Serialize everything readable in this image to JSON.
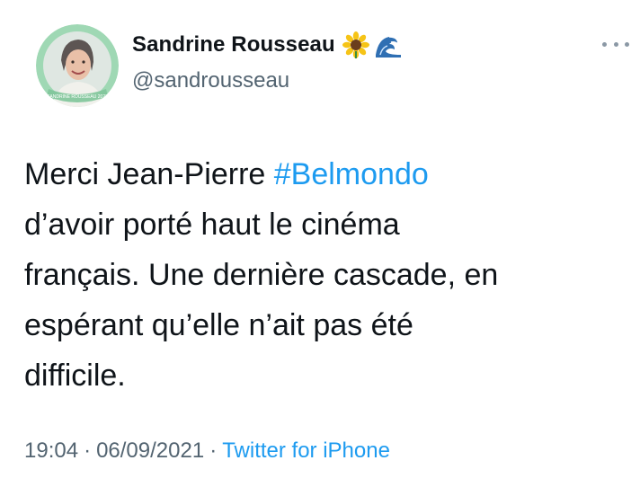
{
  "user": {
    "display_name": "Sandrine Rousseau",
    "handle": "@sandrousseau",
    "name_emojis": [
      "sunflower-emoji",
      "wave-emoji"
    ],
    "avatar_badge_text": "SANDRINE ROUSSEAU 2022"
  },
  "tweet": {
    "line1_before": "Merci Jean-Pierre ",
    "hashtag": "#Belmondo",
    "line2": "d’avoir porté haut le cinéma",
    "line3": "français. Une dernière cascade, en",
    "line4": "espérant qu’elle n’ait pas été",
    "line5": "difficile."
  },
  "meta": {
    "time": "19:04",
    "separator": "·",
    "date": "06/09/2021",
    "source": "Twitter for iPhone"
  },
  "colors": {
    "link": "#1d9bf0",
    "secondary_text": "#536471",
    "primary_text": "#0f1419",
    "avatar_ring": "#8fcfa8"
  }
}
